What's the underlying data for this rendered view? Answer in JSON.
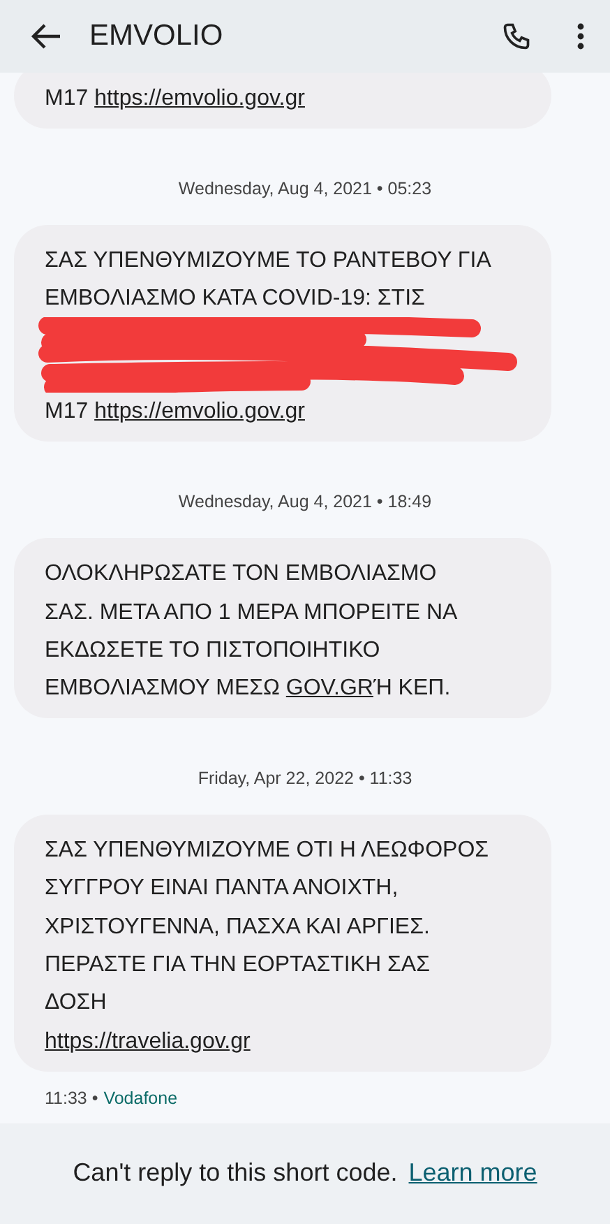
{
  "header": {
    "title": "EMVOLIO"
  },
  "messages": [
    {
      "segments": [
        {
          "kind": "text",
          "text": "M17 "
        },
        {
          "kind": "link",
          "text": "https://emvolio.gov.gr"
        }
      ]
    },
    {
      "date": "Wednesday, Aug 4, 2021 • 05:23",
      "segments": [
        {
          "kind": "text",
          "text": "ΣΑΣ ΥΠΕΝΘΥΜΙΖΟΥΜΕ ΤΟ ΡΑΝΤΕΒΟΥ ΓΙΑ\nΕΜΒΟΛΙΑΣΜΟ ΚΑΤΑ COVID-19: ΣΤΙΣ"
        },
        {
          "kind": "redaction"
        },
        {
          "kind": "text",
          "text": "M17 "
        },
        {
          "kind": "link",
          "text": "https://emvolio.gov.gr"
        }
      ]
    },
    {
      "date": "Wednesday, Aug 4, 2021 • 18:49",
      "segments": [
        {
          "kind": "text",
          "text": "ΟΛΟΚΛΗΡΩΣΑΤΕ ΤΟΝ ΕΜΒΟΛΙΑΣΜΟ\nΣΑΣ. ΜΕΤΑ ΑΠΟ 1 ΜΕΡΑ ΜΠΟΡΕΙΤΕ ΝΑ\nΕΚΔΩΣΕΤΕ ΤΟ ΠΙΣΤΟΠΟΙΗΤΙΚΟ\nΕΜΒΟΛΙΑΣΜΟΥ ΜΕΣΩ "
        },
        {
          "kind": "link",
          "text": "GOV.GR"
        },
        {
          "kind": "text",
          "text": "Ή ΚΕΠ."
        }
      ]
    },
    {
      "date": "Friday, Apr 22, 2022 • 11:33",
      "segments": [
        {
          "kind": "text",
          "text": "ΣΑΣ ΥΠΕΝΘΥΜΙΖΟΥΜΕ ΟΤΙ Η ΛΕΩΦΟΡΟΣ\nΣΥΓΓΡΟΥ ΕΙΝΑΙ ΠΑΝΤΑ ΑΝΟΙΧΤΗ,\nΧΡΙΣΤΟΥΓΕΝΝΑ, ΠΑΣΧΑ ΚΑΙ ΑΡΓΙΕΣ.\nΠΕΡΑΣΤΕ ΓΙΑ ΤΗΝ ΕΟΡΤΑΣΤΙΚΗ ΣΑΣ\nΔΟΣΗ\n"
        },
        {
          "kind": "link",
          "text": "https://travelia.gov.gr"
        }
      ],
      "time": "11:33 •",
      "carrier": "Vodafone"
    }
  ],
  "footer": {
    "text": "Can't reply to this short code.",
    "link": "Learn more"
  }
}
